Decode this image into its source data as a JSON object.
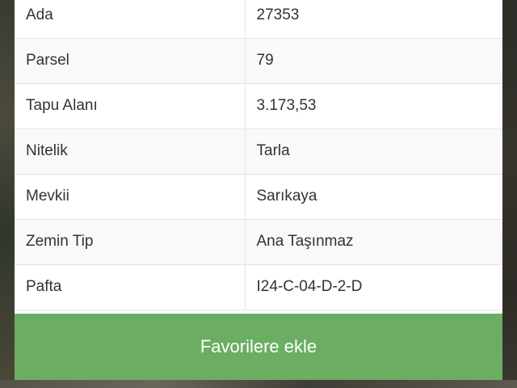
{
  "details": {
    "rows": [
      {
        "label": "Ada",
        "value": "27353"
      },
      {
        "label": "Parsel",
        "value": "79"
      },
      {
        "label": "Tapu Alanı",
        "value": "3.173,53"
      },
      {
        "label": "Nitelik",
        "value": "Tarla"
      },
      {
        "label": "Mevkii",
        "value": "Sarıkaya"
      },
      {
        "label": "Zemin Tip",
        "value": "Ana Taşınmaz"
      },
      {
        "label": "Pafta",
        "value": "I24-C-04-D-2-D"
      }
    ]
  },
  "actions": {
    "favorite_label": "Favorilere ekle"
  },
  "colors": {
    "button_green": "#6bae63",
    "text": "#333333",
    "divider": "#e3e3e3"
  }
}
